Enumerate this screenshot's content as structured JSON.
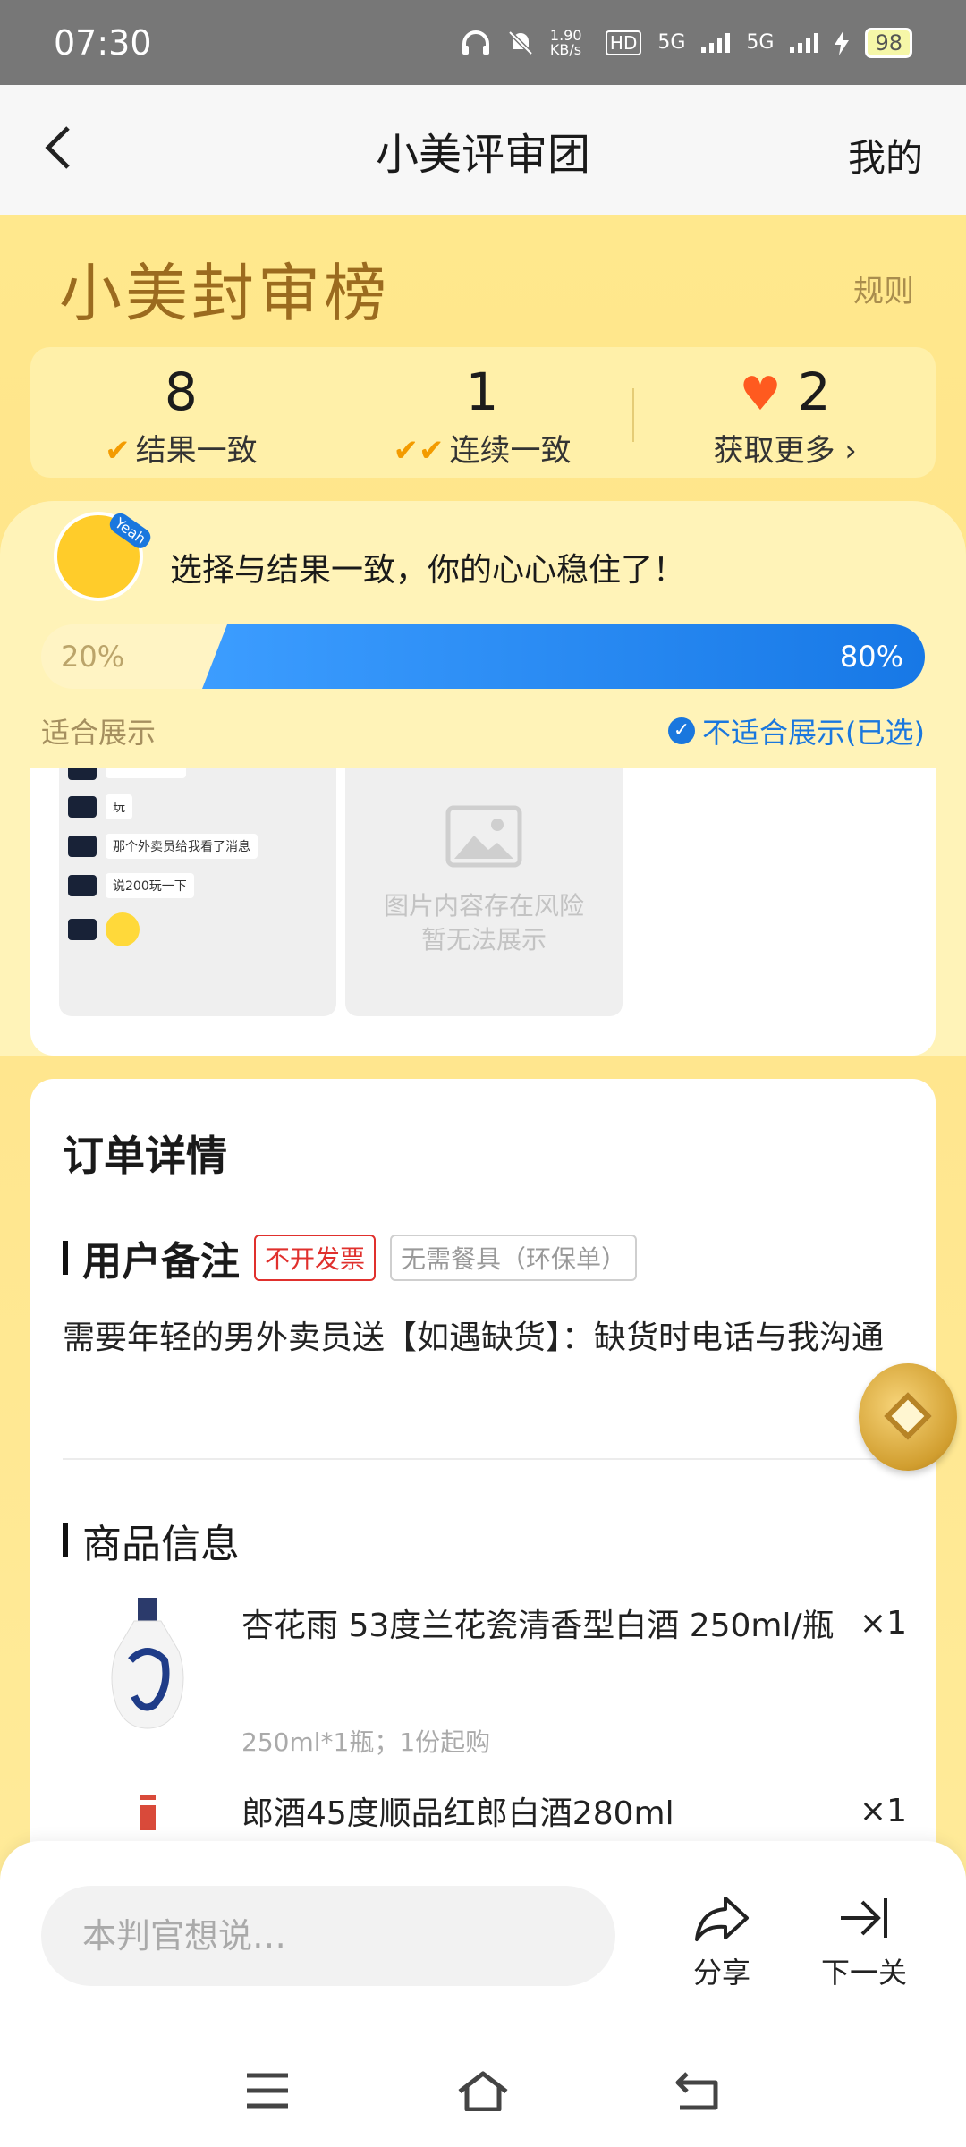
{
  "status_bar": {
    "time": "07:30",
    "net_speed": "1.90 KB/s",
    "network_1": "5G",
    "network_2": "5G",
    "battery": "98",
    "icons": [
      "headphones-icon",
      "bell-mute-icon",
      "hd-icon",
      "signal-icon",
      "signal-icon",
      "charging-icon",
      "battery-icon"
    ]
  },
  "navbar": {
    "title": "小美评审团",
    "right_link": "我的",
    "back_icon": "chevron-left-icon"
  },
  "hero": {
    "title": "小美封审榜",
    "rules_link": "规则"
  },
  "stats": [
    {
      "value": "8",
      "label": "结果一致",
      "icon": "check-icon"
    },
    {
      "value": "1",
      "label": "连续一致",
      "icon": "double-check-icon"
    },
    {
      "value": "2",
      "label": "获取更多",
      "icon": "heart-icon"
    }
  ],
  "judge": {
    "mascot_badge": "Yeah",
    "message": "选择与结果一致，你的心心稳住了！",
    "left_percent": "20%",
    "right_percent": "80%",
    "left_fraction": 0.2,
    "left_choice": "适合展示",
    "right_choice": "不适合展示(已选)",
    "chat_messages": [
      "玩",
      "那个外卖员给我看了消息",
      "说200玩一下"
    ],
    "risk_text_line1": "图片内容存在风险",
    "risk_text_line2": "暂无法展示"
  },
  "order": {
    "title": "订单详情",
    "note_section": "用户备注",
    "tag_invoice": "不开发票",
    "tag_tableware": "无需餐具（环保单）",
    "note_text": "需要年轻的男外卖员送【如遇缺货】：缺货时电话与我沟通",
    "goods_section": "商品信息",
    "items": [
      {
        "name": "杏花雨 53度兰花瓷清香型白酒 250ml/瓶",
        "qty": "×1",
        "spec": "250ml*1瓶；1份起购"
      },
      {
        "name": "郎酒45度顺品红郎白酒280ml",
        "qty": "×1",
        "spec": ""
      }
    ]
  },
  "bottom": {
    "comment_placeholder": "本判官想说…",
    "share_label": "分享",
    "next_label": "下一关"
  },
  "colors": {
    "accent_blue": "#1a77de",
    "gold": "#9b6b1f",
    "invoice_red": "#e0302d",
    "heart": "#ff5a1f"
  }
}
